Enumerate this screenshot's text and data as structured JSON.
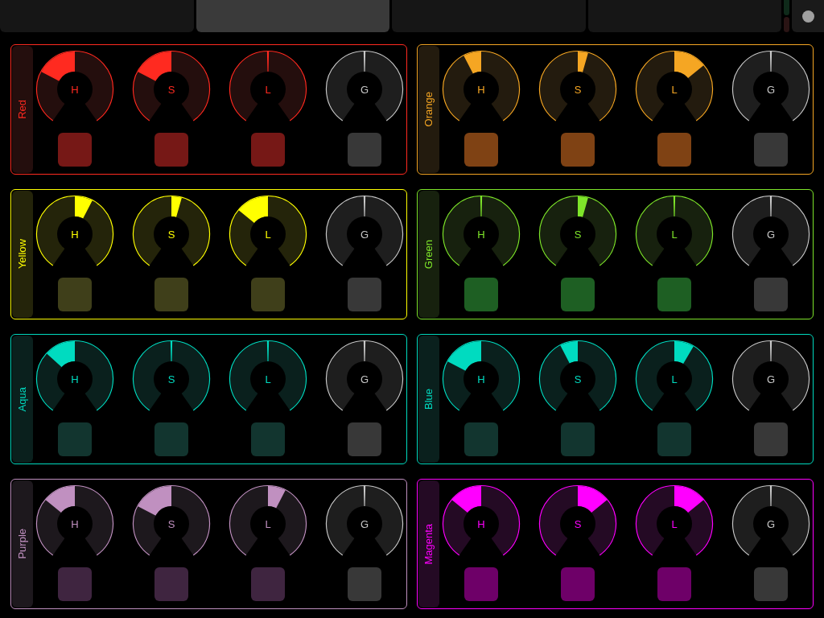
{
  "tabs": [
    {
      "selected": false
    },
    {
      "selected": true
    },
    {
      "selected": false
    },
    {
      "selected": false
    }
  ],
  "groups": [
    {
      "name": "Red",
      "color": "#ff2a20",
      "knobs": [
        {
          "label": "H",
          "level": 0.29,
          "color": "#ff2a20",
          "pad": {
            "color": "#761816"
          }
        },
        {
          "label": "S",
          "level": 0.29,
          "color": "#ff2a20",
          "pad": {
            "color": "#761816"
          }
        },
        {
          "label": "L",
          "level": 0.5,
          "color": "#ff2a20",
          "pad": {
            "color": "#761816"
          }
        },
        {
          "label": "G",
          "level": 0.5,
          "color": "#c8c8c8",
          "pad": {
            "color": "#383838"
          }
        }
      ]
    },
    {
      "name": "Orange",
      "color": "#f5a623",
      "knobs": [
        {
          "label": "H",
          "level": 0.41,
          "color": "#f5a623",
          "pad": {
            "color": "#7f4214"
          }
        },
        {
          "label": "S",
          "level": 0.55,
          "color": "#f5a623",
          "pad": {
            "color": "#7f4214"
          }
        },
        {
          "label": "L",
          "level": 0.67,
          "color": "#f5a623",
          "pad": {
            "color": "#7f4214"
          }
        },
        {
          "label": "G",
          "level": 0.5,
          "color": "#c8c8c8",
          "pad": {
            "color": "#383838"
          }
        }
      ]
    },
    {
      "name": "Yellow",
      "color": "#ffff00",
      "knobs": [
        {
          "label": "H",
          "level": 0.59,
          "color": "#ffff00",
          "pad": {
            "color": "#3f3f1a"
          }
        },
        {
          "label": "S",
          "level": 0.55,
          "color": "#ffff00",
          "pad": {
            "color": "#3f3f1a"
          }
        },
        {
          "label": "L",
          "level": 0.33,
          "color": "#ffff00",
          "pad": {
            "color": "#3f3f1a"
          }
        },
        {
          "label": "G",
          "level": 0.5,
          "color": "#c8c8c8",
          "pad": {
            "color": "#383838"
          }
        }
      ]
    },
    {
      "name": "Green",
      "color": "#7ee52a",
      "knobs": [
        {
          "label": "H",
          "level": 0.5,
          "color": "#7ee52a",
          "pad": {
            "color": "#1e5f23"
          }
        },
        {
          "label": "S",
          "level": 0.55,
          "color": "#7ee52a",
          "pad": {
            "color": "#1e5f23"
          }
        },
        {
          "label": "L",
          "level": 0.5,
          "color": "#7ee52a",
          "pad": {
            "color": "#1e5f23"
          }
        },
        {
          "label": "G",
          "level": 0.5,
          "color": "#c8c8c8",
          "pad": {
            "color": "#383838"
          }
        }
      ]
    },
    {
      "name": "Aqua",
      "color": "#00dbc0",
      "knobs": [
        {
          "label": "H",
          "level": 0.34,
          "color": "#00dbc0",
          "pad": {
            "color": "#12352f"
          }
        },
        {
          "label": "S",
          "level": 0.5,
          "color": "#00dbc0",
          "pad": {
            "color": "#12352f"
          }
        },
        {
          "label": "L",
          "level": 0.5,
          "color": "#00dbc0",
          "pad": {
            "color": "#12352f"
          }
        },
        {
          "label": "G",
          "level": 0.5,
          "color": "#c8c8c8",
          "pad": {
            "color": "#383838"
          }
        }
      ]
    },
    {
      "name": "Blue",
      "color": "#00dbc0",
      "knobs": [
        {
          "label": "H",
          "level": 0.29,
          "color": "#00dbc0",
          "pad": {
            "color": "#12352f"
          }
        },
        {
          "label": "S",
          "level": 0.41,
          "color": "#00dbc0",
          "pad": {
            "color": "#12352f"
          }
        },
        {
          "label": "L",
          "level": 0.6,
          "color": "#00dbc0",
          "pad": {
            "color": "#12352f"
          }
        },
        {
          "label": "G",
          "level": 0.5,
          "color": "#c8c8c8",
          "pad": {
            "color": "#383838"
          }
        }
      ]
    },
    {
      "name": "Purple",
      "color": "#c090c0",
      "knobs": [
        {
          "label": "H",
          "level": 0.33,
          "color": "#c090c0",
          "pad": {
            "color": "#3f2540"
          }
        },
        {
          "label": "S",
          "level": 0.29,
          "color": "#c090c0",
          "pad": {
            "color": "#3f2540"
          }
        },
        {
          "label": "L",
          "level": 0.59,
          "color": "#c090c0",
          "pad": {
            "color": "#3f2540"
          }
        },
        {
          "label": "G",
          "level": 0.5,
          "color": "#c8c8c8",
          "pad": {
            "color": "#383838"
          }
        }
      ]
    },
    {
      "name": "Magenta",
      "color": "#ff00ff",
      "knobs": [
        {
          "label": "H",
          "level": 0.33,
          "color": "#ff00ff",
          "pad": {
            "color": "#6e0068"
          }
        },
        {
          "label": "S",
          "level": 0.67,
          "color": "#ff00ff",
          "pad": {
            "color": "#6e0068"
          }
        },
        {
          "label": "L",
          "level": 0.67,
          "color": "#ff00ff",
          "pad": {
            "color": "#6e0068"
          }
        },
        {
          "label": "G",
          "level": 0.5,
          "color": "#c8c8c8",
          "pad": {
            "color": "#383838"
          }
        }
      ]
    }
  ]
}
